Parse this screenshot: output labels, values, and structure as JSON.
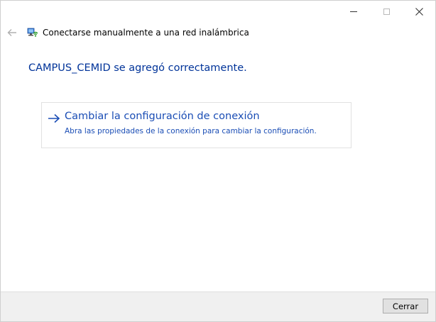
{
  "window": {
    "title": "Conectarse manualmente a una red inalámbrica",
    "icons": {
      "back": "back-arrow-icon",
      "wizard": "network-wizard-icon",
      "minimize": "minimize-icon",
      "maximize": "maximize-icon",
      "close": "close-icon"
    }
  },
  "main": {
    "heading": "CAMPUS_CEMID se agregó correctamente.",
    "command_link": {
      "title": "Cambiar la configuración de conexión",
      "description": "Abra las propiedades de la conexión para cambiar la configuración.",
      "icon": "arrow-right-icon"
    }
  },
  "footer": {
    "close_label": "Cerrar"
  },
  "colors": {
    "heading": "#003399",
    "link": "#1a4db5",
    "footer_bg": "#f0f0f0"
  }
}
